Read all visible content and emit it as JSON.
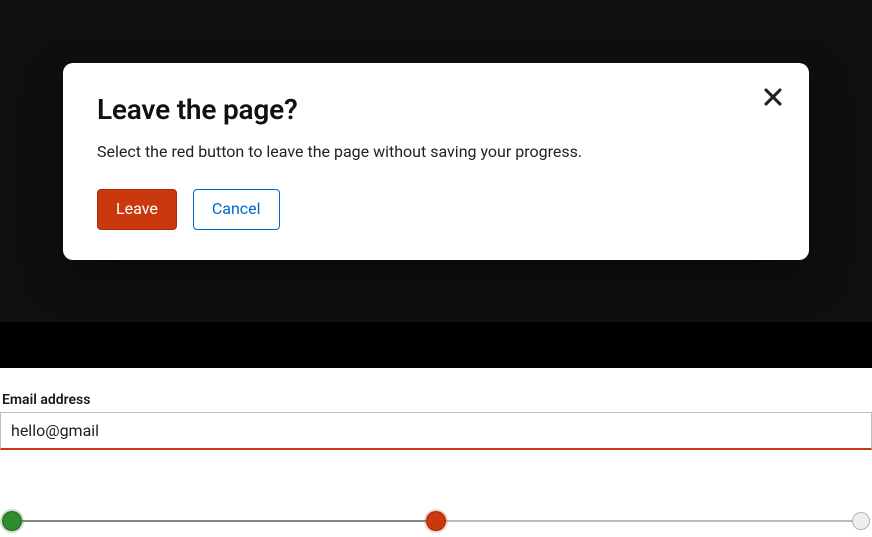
{
  "modal": {
    "title": "Leave the page?",
    "body": "Select the red button to leave the page without saving your progress.",
    "primary_label": "Leave",
    "secondary_label": "Cancel"
  },
  "form": {
    "email_label": "Email address",
    "email_value": "hello@gmail"
  },
  "slider": {
    "min": 0,
    "mid": 50,
    "max": 100,
    "current": 50
  },
  "colors": {
    "danger": "#c9390d",
    "link": "#0066cc",
    "success": "#2e8b2e"
  }
}
